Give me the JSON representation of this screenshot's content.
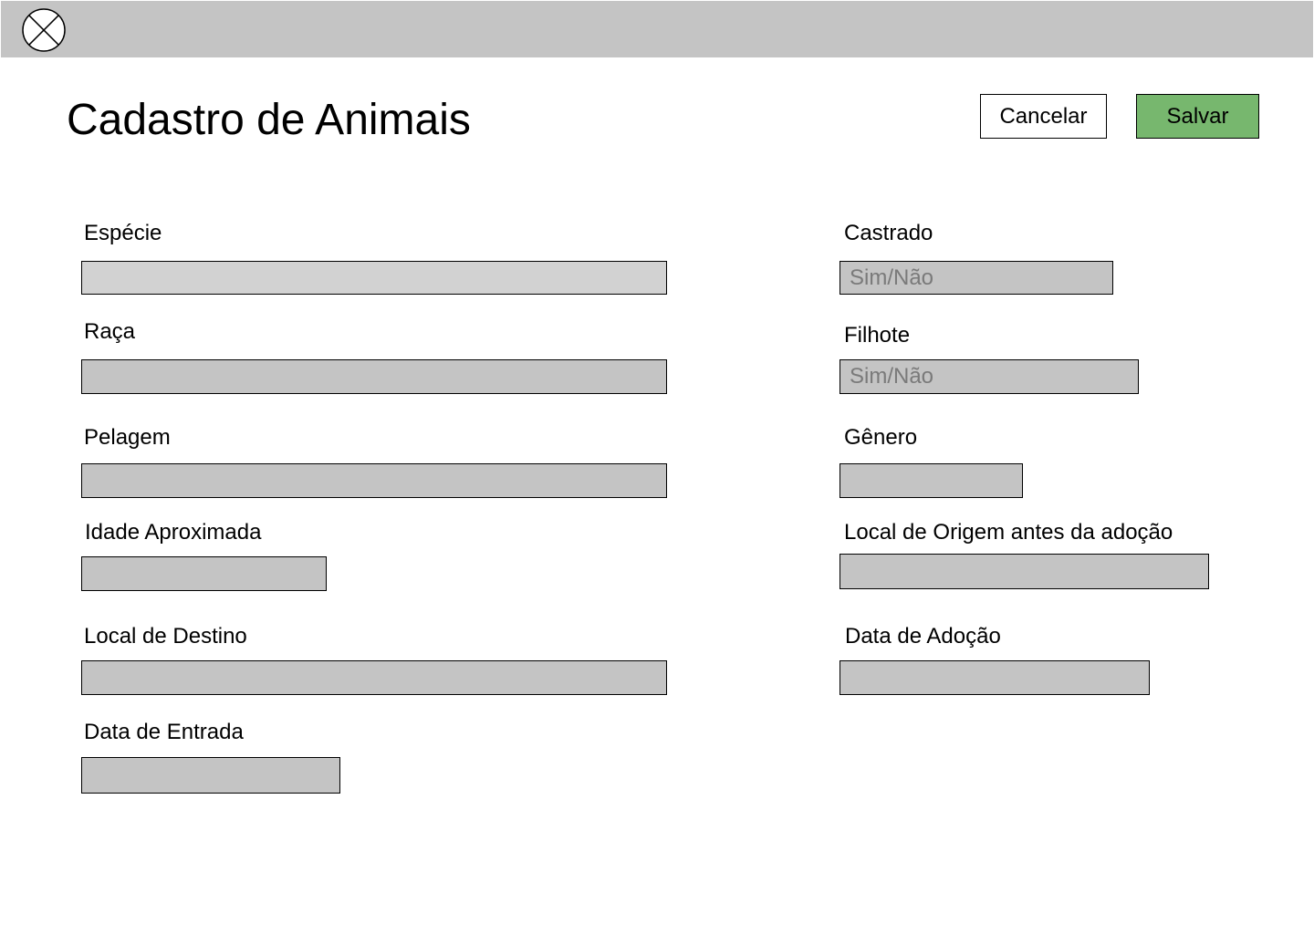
{
  "header": {
    "logo_icon": "close-circle-icon"
  },
  "page": {
    "title": "Cadastro de Animais"
  },
  "actions": {
    "cancel_label": "Cancelar",
    "save_label": "Salvar",
    "save_color": "#77b76e"
  },
  "form": {
    "especie": {
      "label": "Espécie",
      "value": "",
      "placeholder": ""
    },
    "raca": {
      "label": "Raça",
      "value": "",
      "placeholder": ""
    },
    "pelagem": {
      "label": "Pelagem",
      "value": "",
      "placeholder": ""
    },
    "idade": {
      "label": "Idade Aproximada",
      "value": "",
      "placeholder": ""
    },
    "destino": {
      "label": "Local de Destino",
      "value": "",
      "placeholder": ""
    },
    "entrada": {
      "label": "Data de Entrada",
      "value": "",
      "placeholder": ""
    },
    "castrado": {
      "label": "Castrado",
      "value": "",
      "placeholder": "Sim/Não"
    },
    "filhote": {
      "label": "Filhote",
      "value": "",
      "placeholder": "Sim/Não"
    },
    "genero": {
      "label": "Gênero",
      "value": "",
      "placeholder": ""
    },
    "origem": {
      "label": "Local de Origem antes da adoção",
      "value": "",
      "placeholder": ""
    },
    "adocao": {
      "label": "Data de Adoção",
      "value": "",
      "placeholder": ""
    }
  }
}
